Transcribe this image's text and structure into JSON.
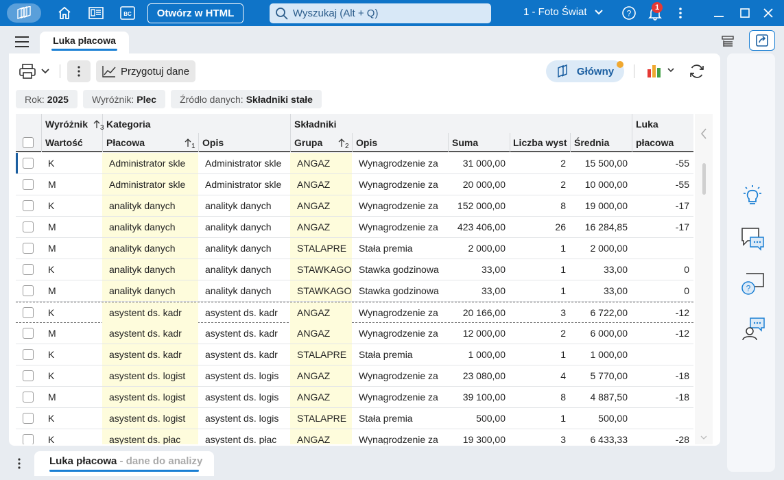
{
  "titlebar": {
    "open_html": "Otwórz w HTML",
    "search_placeholder": "Wyszukaj (Alt + Q)",
    "company": "1 - Foto Świat",
    "notifications": "1",
    "icons": [
      "app-logo-icon",
      "home-icon",
      "list-window-icon",
      "bc-icon",
      "search-icon",
      "chevron-down-icon",
      "help-icon",
      "bell-icon",
      "more-vertical-icon",
      "minimize-icon",
      "maximize-icon",
      "close-icon"
    ]
  },
  "tabs": {
    "active": "Luka płacowa"
  },
  "toolbar": {
    "prepare": "Przygotuj dane",
    "view": "Główny"
  },
  "filters": [
    {
      "label": "Rok:",
      "value": "2025"
    },
    {
      "label": "Wyróżnik:",
      "value": "Plec"
    },
    {
      "label": "Źródło danych:",
      "value": "Składniki stałe"
    }
  ],
  "grid": {
    "group_headers": {
      "wyroznik": "Wyróżnik",
      "kategoria": "Kategoria",
      "skladniki": "Składniki",
      "luka": "Luka"
    },
    "columns": {
      "wartosc": "Wartość",
      "placowa": "Płacowa",
      "opis": "Opis",
      "grupa": "Grupa",
      "opis2": "Opis",
      "suma": "Suma",
      "liczba": "Liczba wyst",
      "srednia": "Średnia",
      "luka": "płacowa"
    },
    "sort_marks": {
      "wyroznik": "3",
      "placowa": "1",
      "grupa": "2"
    },
    "rows": [
      {
        "w": "K",
        "p": "Administrator skle",
        "o": "Administrator skle",
        "g": "ANGAZ",
        "o2": "Wynagrodzenie za",
        "s": "31 000,00",
        "l": "2",
        "sr": "15 500,00",
        "lk": "-55"
      },
      {
        "w": "M",
        "p": "Administrator skle",
        "o": "Administrator skle",
        "g": "ANGAZ",
        "o2": "Wynagrodzenie za",
        "s": "20 000,00",
        "l": "2",
        "sr": "10 000,00",
        "lk": "-55"
      },
      {
        "w": "K",
        "p": "analityk danych",
        "o": "analityk danych",
        "g": "ANGAZ",
        "o2": "Wynagrodzenie za",
        "s": "152 000,00",
        "l": "8",
        "sr": "19 000,00",
        "lk": "-17"
      },
      {
        "w": "M",
        "p": "analityk danych",
        "o": "analityk danych",
        "g": "ANGAZ",
        "o2": "Wynagrodzenie za",
        "s": "423 406,00",
        "l": "26",
        "sr": "16 284,85",
        "lk": "-17"
      },
      {
        "w": "M",
        "p": "analityk danych",
        "o": "analityk danych",
        "g": "STALAPRE",
        "o2": "Stała premia",
        "s": "2 000,00",
        "l": "1",
        "sr": "2 000,00",
        "lk": ""
      },
      {
        "w": "K",
        "p": "analityk danych",
        "o": "analityk danych",
        "g": "STAWKAGO",
        "o2": "Stawka godzinowa",
        "s": "33,00",
        "l": "1",
        "sr": "33,00",
        "lk": "0"
      },
      {
        "w": "M",
        "p": "analityk danych",
        "o": "analityk danych",
        "g": "STAWKAGO",
        "o2": "Stawka godzinowa",
        "s": "33,00",
        "l": "1",
        "sr": "33,00",
        "lk": "0"
      },
      {
        "w": "K",
        "p": "asystent ds. kadr",
        "o": "asystent ds. kadr",
        "g": "ANGAZ",
        "o2": "Wynagrodzenie za",
        "s": "20 166,00",
        "l": "3",
        "sr": "6 722,00",
        "lk": "-12"
      },
      {
        "w": "M",
        "p": "asystent ds. kadr",
        "o": "asystent ds. kadr",
        "g": "ANGAZ",
        "o2": "Wynagrodzenie za",
        "s": "12 000,00",
        "l": "2",
        "sr": "6 000,00",
        "lk": "-12"
      },
      {
        "w": "K",
        "p": "asystent ds. kadr",
        "o": "asystent ds. kadr",
        "g": "STALAPRE",
        "o2": "Stała premia",
        "s": "1 000,00",
        "l": "1",
        "sr": "1 000,00",
        "lk": ""
      },
      {
        "w": "K",
        "p": "asystent ds. logist",
        "o": "asystent ds. logis",
        "g": "ANGAZ",
        "o2": "Wynagrodzenie za",
        "s": "23 080,00",
        "l": "4",
        "sr": "5 770,00",
        "lk": "-18"
      },
      {
        "w": "M",
        "p": "asystent ds. logist",
        "o": "asystent ds. logis",
        "g": "ANGAZ",
        "o2": "Wynagrodzenie za",
        "s": "39 100,00",
        "l": "8",
        "sr": "4 887,50",
        "lk": "-18"
      },
      {
        "w": "K",
        "p": "asystent ds. logist",
        "o": "asystent ds. logis",
        "g": "STALAPRE",
        "o2": "Stała premia",
        "s": "500,00",
        "l": "1",
        "sr": "500,00",
        "lk": ""
      },
      {
        "w": "K",
        "p": "asystent ds. płac",
        "o": "asystent ds. płac",
        "g": "ANGAZ",
        "o2": "Wynagrodzenie za",
        "s": "19 300,00",
        "l": "3",
        "sr": "6 433,33",
        "lk": "-28"
      }
    ]
  },
  "bottom_tab": {
    "label_main": "Luka płacowa",
    "label_fade": " - dane do analizy"
  },
  "colors": {
    "titlebar": "#0f74c8",
    "accent": "#1a7fd4",
    "highlight": "#fefcdc"
  }
}
